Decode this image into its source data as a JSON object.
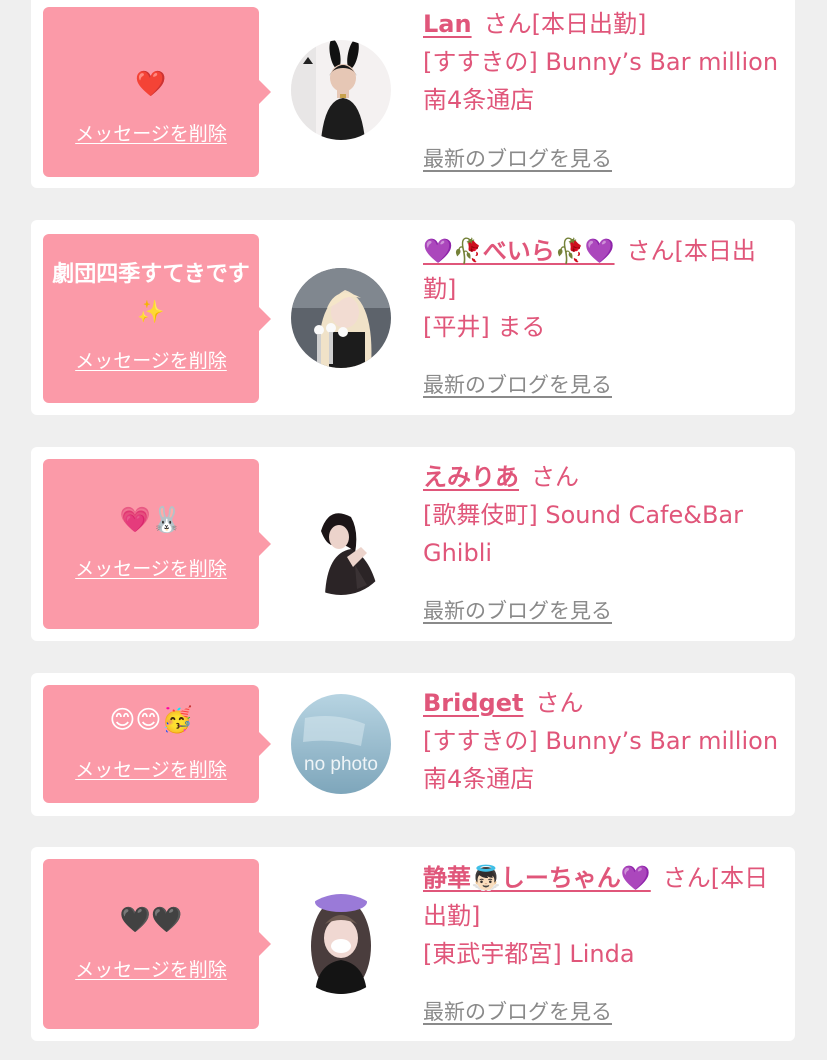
{
  "delete_label": "メッセージを削除",
  "blog_label": "最新のブログを見る",
  "san_label": "さん",
  "cards": [
    {
      "message": "❤️",
      "name": "Lan",
      "suffix": "さん[本日出勤]",
      "detail": "[すすきの] Bunny’s Bar million 南4条通店",
      "avatar_icon": "bunny-girl-photo"
    },
    {
      "message": "劇団四季すてきです✨",
      "name": "💜🥀べいら🥀💜",
      "suffix": "さん[本日出勤]",
      "detail": "[平井] まる",
      "avatar_icon": "blonde-girl-photo"
    },
    {
      "message": "💗🐰",
      "name": "えみりあ",
      "suffix": "さん",
      "detail": "[歌舞伎町] Sound Cafe&Bar Ghibli",
      "avatar_icon": "dark-hair-girl-photo"
    },
    {
      "message": "😊😊🥳",
      "name": "Bridget",
      "suffix": "さん",
      "detail": "[すすきの] Bunny’s Bar million 南4条通店",
      "avatar_icon": "no-photo-placeholder",
      "avatar_text": "no photo"
    },
    {
      "message": "🖤🖤",
      "name": "静華👼🏻しーちゃん💜",
      "suffix": "さん[本日出勤]",
      "detail": "[東武宇都宮] Linda",
      "avatar_icon": "masked-girl-photo"
    }
  ],
  "colors": {
    "background": "#efefef",
    "card": "#ffffff",
    "bubble": "#fb9aa8",
    "accent": "#e0567a",
    "link_gray": "#8a8a8a"
  }
}
